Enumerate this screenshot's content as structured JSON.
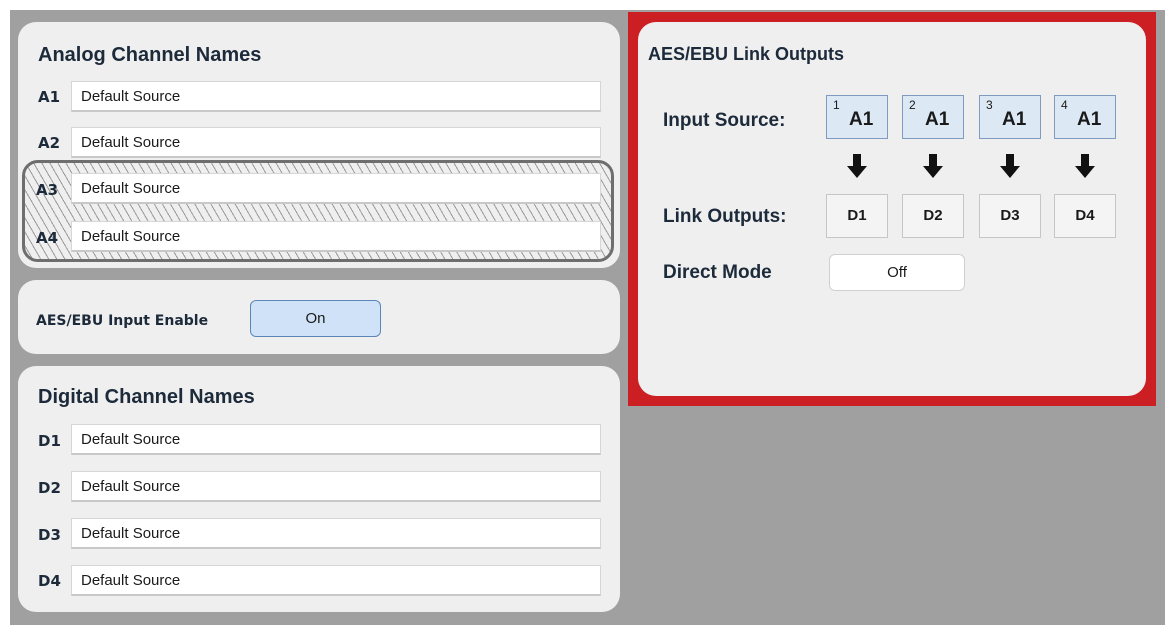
{
  "analog": {
    "title": "Analog Channel Names",
    "channels": [
      {
        "label": "A1",
        "value": "Default Source"
      },
      {
        "label": "A2",
        "value": "Default Source"
      },
      {
        "label": "A3",
        "value": "Default Source"
      },
      {
        "label": "A4",
        "value": "Default Source"
      }
    ]
  },
  "aes_input": {
    "label": "AES/EBU Input Enable",
    "value": "On"
  },
  "digital": {
    "title": "Digital Channel Names",
    "channels": [
      {
        "label": "D1",
        "value": "Default Source"
      },
      {
        "label": "D2",
        "value": "Default Source"
      },
      {
        "label": "D3",
        "value": "Default Source"
      },
      {
        "label": "D4",
        "value": "Default Source"
      }
    ]
  },
  "link": {
    "title": "AES/EBU Link Outputs",
    "input_source_label": "Input Source:",
    "sources": [
      {
        "num": "1",
        "value": "A1"
      },
      {
        "num": "2",
        "value": "A1"
      },
      {
        "num": "3",
        "value": "A1"
      },
      {
        "num": "4",
        "value": "A1"
      }
    ],
    "link_outputs_label": "Link Outputs:",
    "outputs": [
      "D1",
      "D2",
      "D3",
      "D4"
    ],
    "direct_mode_label": "Direct Mode",
    "direct_mode_value": "Off"
  },
  "colors": {
    "highlight_border": "#cc1f24",
    "toggle_on_bg": "#cfe2f7",
    "source_bg": "#dce8f4"
  }
}
